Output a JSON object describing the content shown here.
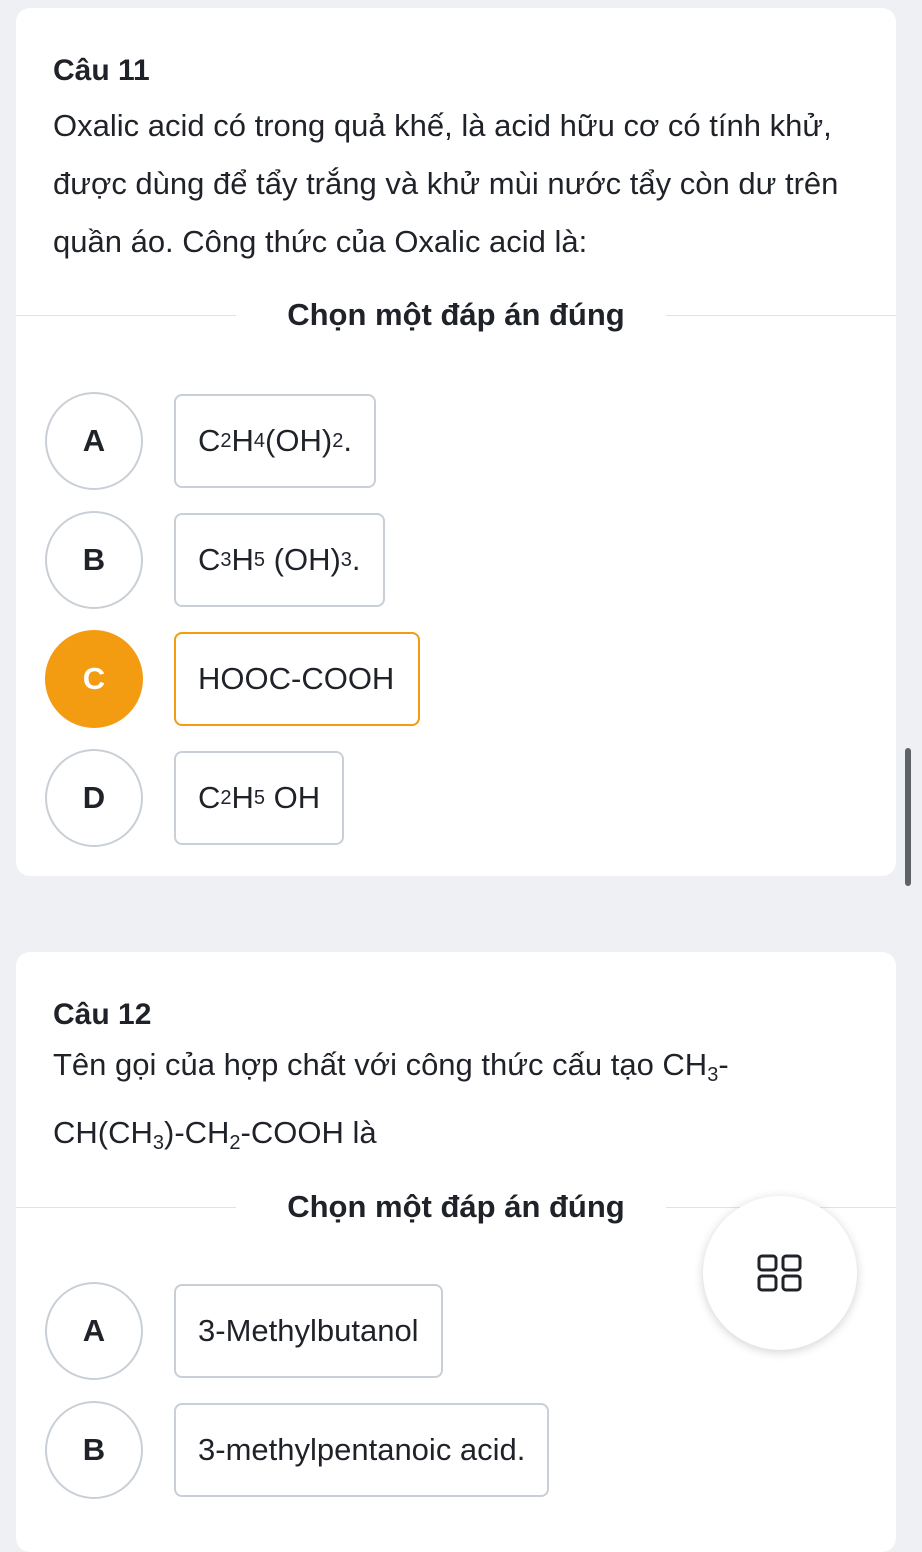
{
  "questions": [
    {
      "title": "Câu 11",
      "text": "Oxalic acid có trong quả khế, là acid hữu cơ có tính khử, được dùng để tẩy trắng và khử mùi nước tẩy còn dư trên quần áo. Công thức của Oxalic acid là:",
      "instruction": "Chọn một đáp án đúng",
      "options": [
        {
          "letter": "A",
          "parts": [
            "C",
            "2",
            "H",
            "4",
            "(OH)",
            "2",
            "."
          ],
          "selected": false
        },
        {
          "letter": "B",
          "parts": [
            "C",
            "3",
            "H",
            "5",
            " (OH)",
            "3",
            "."
          ],
          "selected": false
        },
        {
          "letter": "C",
          "text": "HOOC-COOH",
          "selected": true
        },
        {
          "letter": "D",
          "parts": [
            "C",
            "2",
            "H",
            "5",
            " OH"
          ],
          "selected": false
        }
      ]
    },
    {
      "title": "Câu 12",
      "text_parts": [
        "Tên gọi của hợp chất với công thức cấu tạo CH",
        "3",
        "-",
        "CH(CH",
        "3",
        ")-CH",
        "2",
        "-COOH là"
      ],
      "instruction": "Chọn một đáp án đúng",
      "options": [
        {
          "letter": "A",
          "text": "3-Methylbutanol",
          "selected": false
        },
        {
          "letter": "B",
          "text": "3-methylpentanoic acid.",
          "selected": false
        }
      ]
    }
  ],
  "fab_icon": "grid-icon",
  "colors": {
    "accent": "#f39c12",
    "background": "#eef0f4",
    "card": "#ffffff",
    "border": "#c9cfd6",
    "text": "#1f2329"
  }
}
